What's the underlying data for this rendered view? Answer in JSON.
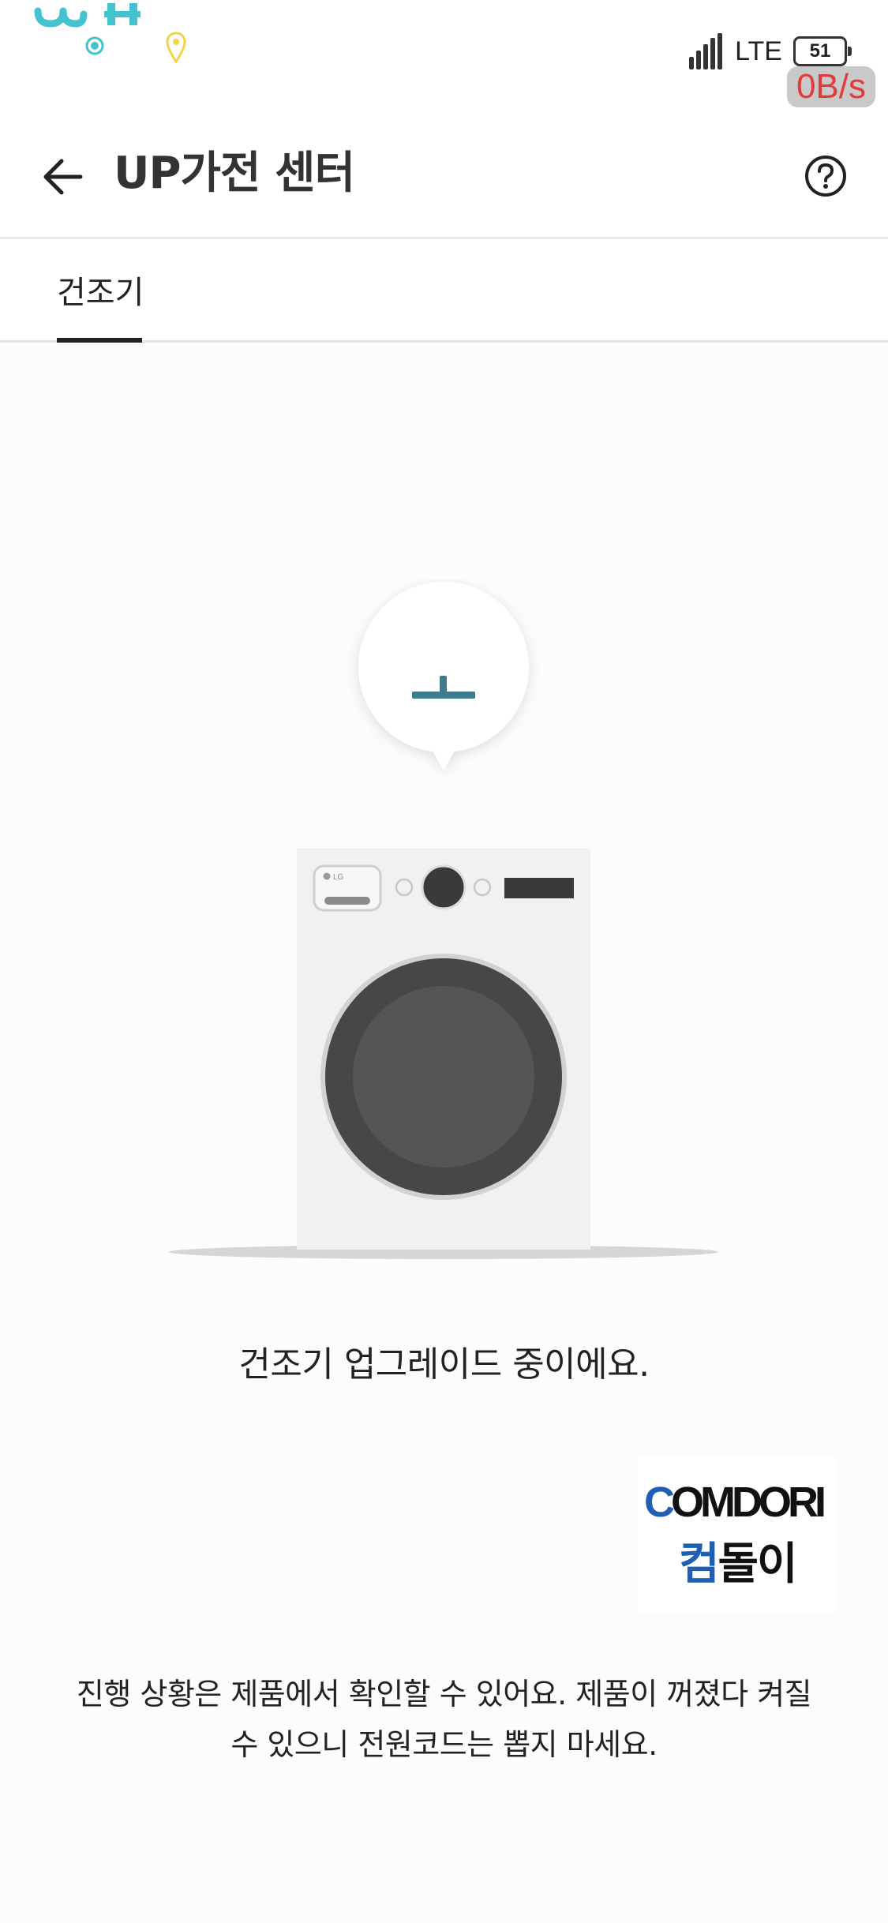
{
  "status_bar": {
    "network": "LTE",
    "battery": "51",
    "net_speed": "0B/s",
    "icons": [
      "signal-icon",
      "battery-icon",
      "location-pin-icon"
    ]
  },
  "app_bar": {
    "title": "UP가전 센터",
    "back_icon": "arrow-left-icon",
    "help_icon": "question-circle-icon"
  },
  "tabs": [
    {
      "label": "건조기",
      "selected": true
    }
  ],
  "main": {
    "illustration": "dryer-with-progress-bubble",
    "device_badge": "LG",
    "status_message": "건조기 업그레이드 중이에요.",
    "notice_line1": "진행 상황은 제품에서 확인할 수 있어요. 제품이 꺼졌다 켜질",
    "notice_line2": "수 있으니 전원코드는 뽑지 마세요."
  },
  "watermark": {
    "en_first": "C",
    "en_rest": "OMDORI",
    "ko_first": "컴",
    "ko_rest": "돌이"
  },
  "colors": {
    "accent": "#3f7b8f",
    "watermark_blue": "#1f5fb4",
    "speed_red": "#e23b3b",
    "dryer_body": "#f1f1f1",
    "dryer_drum": "#474747"
  }
}
